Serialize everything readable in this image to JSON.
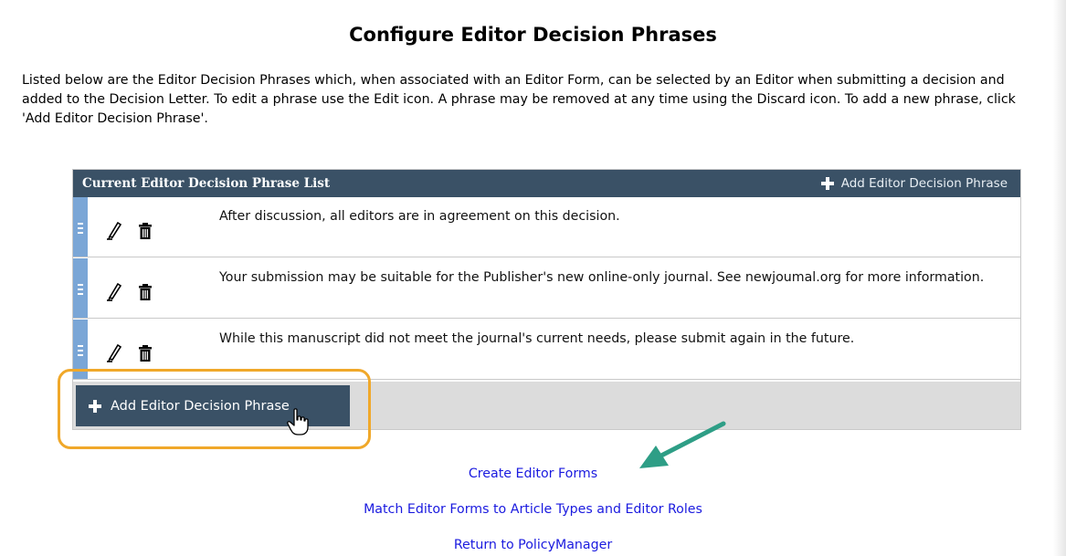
{
  "page": {
    "title": "Configure Editor Decision Phrases",
    "intro": "Listed below are the Editor Decision Phrases which, when associated with an Editor Form, can be selected by an Editor when submitting a decision and added to the Decision Letter. To edit a phrase use the Edit icon. A phrase may be removed at any time using the Discard icon. To add a new phrase, click 'Add Editor Decision Phrase'."
  },
  "table": {
    "header_title": "Current Editor Decision Phrase List",
    "header_add_label": "Add Editor Decision Phrase",
    "rows": [
      {
        "text": "After discussion, all editors are in agreement on this decision."
      },
      {
        "text": "Your submission may be suitable for the Publisher's new online-only journal. See newjoumal.org for more information."
      },
      {
        "text": "While this manuscript did not meet the journal's current needs, please submit again in the future."
      }
    ],
    "add_button_label": "Add Editor Decision Phrase"
  },
  "links": {
    "create_forms": "Create Editor Forms",
    "match_forms": "Match Editor Forms to Article Types and Editor Roles",
    "return": "Return to PolicyManager"
  },
  "colors": {
    "header_bg": "#3a5166",
    "drag_handle": "#7aa6d6",
    "highlight": "#f0a82a",
    "arrow": "#2e9e86",
    "link": "#1a1adf"
  },
  "icons": [
    "plus-icon",
    "edit-icon",
    "trash-icon",
    "drag-handle-icon",
    "hand-cursor-icon",
    "arrow-icon"
  ]
}
